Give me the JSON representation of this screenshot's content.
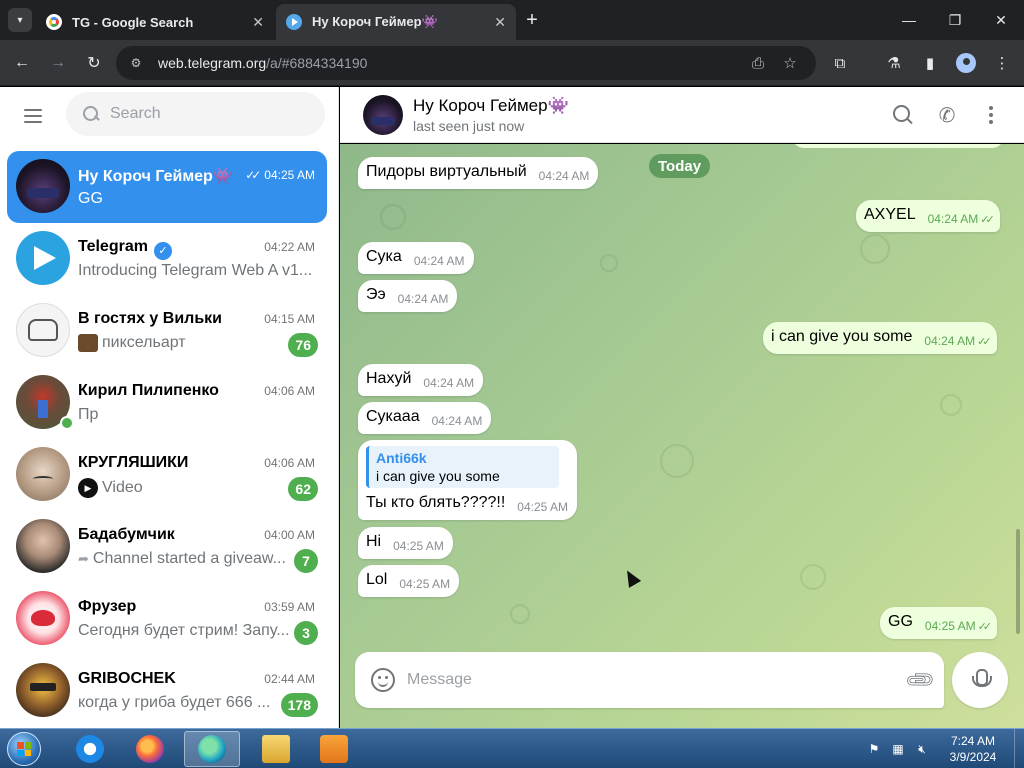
{
  "browser": {
    "tabs": [
      {
        "title": "TG - Google Search",
        "active": false
      },
      {
        "title": "Ну Короч Геймер👾",
        "active": true
      }
    ],
    "url_host": "web.telegram.org",
    "url_path": "/a/#6884334190"
  },
  "sidebar": {
    "search_placeholder": "Search",
    "chats": [
      {
        "name": "Ну Короч Геймер👾",
        "time": "04:25 AM",
        "preview": "GG",
        "badge": "",
        "active": true,
        "read_ticks": "✓✓"
      },
      {
        "name": "Telegram",
        "time": "04:22 AM",
        "preview": "Introducing Telegram Web A v1...",
        "badge": "",
        "verified": true
      },
      {
        "name": "В гостях у Вильки",
        "time": "04:15 AM",
        "preview": "пиксельарт",
        "badge": "76"
      },
      {
        "name": "Кирил Пилипенко",
        "time": "04:06 AM",
        "preview": "Пр",
        "badge": "",
        "online": true
      },
      {
        "name": "КРУГЛЯШИКИ",
        "time": "04:06 AM",
        "preview": "Video",
        "badge": "62"
      },
      {
        "name": "Бадабумчик",
        "time": "04:00 AM",
        "preview": "Channel started a giveaw...",
        "badge": "7"
      },
      {
        "name": "Фрузер",
        "time": "03:59 AM",
        "preview": "Сегодня будет стрим! Запу...",
        "badge": "3"
      },
      {
        "name": "GRIBOCHEK",
        "time": "02:44 AM",
        "preview": "когда у гриба будет 666 ...",
        "badge": "178"
      }
    ]
  },
  "chat": {
    "name": "Ну Короч Геймер👾",
    "status": "last seen just now",
    "date_label": "Today",
    "messages": [
      {
        "dir": "in",
        "text": "Пидоры виртуальный",
        "time": "04:24 AM"
      },
      {
        "dir": "out",
        "text": "AXYEL",
        "time": "04:24 AM"
      },
      {
        "dir": "in",
        "text": "Сука",
        "time": "04:24 AM"
      },
      {
        "dir": "in",
        "text": "Ээ",
        "time": "04:24 AM"
      },
      {
        "dir": "out",
        "text": "i can give you some",
        "time": "04:24 AM"
      },
      {
        "dir": "in",
        "text": "Нахуй",
        "time": "04:24 AM"
      },
      {
        "dir": "in",
        "text": "Сукааа",
        "time": "04:24 AM"
      },
      {
        "dir": "in",
        "text": "Ты кто блять????!!",
        "time": "04:25 AM",
        "reply_name": "Anti66k",
        "reply_text": "i can give you some"
      },
      {
        "dir": "in",
        "text": "Hi",
        "time": "04:25 AM"
      },
      {
        "dir": "in",
        "text": "Lol",
        "time": "04:25 AM"
      },
      {
        "dir": "out",
        "text": "GG",
        "time": "04:25 AM"
      }
    ],
    "composer_placeholder": "Message"
  },
  "taskbar": {
    "time": "7:24 AM",
    "date": "3/9/2024"
  },
  "colors": {
    "accent": "#3390ec",
    "unread_badge": "#4fae4e",
    "outgoing_bubble": "#eeffde"
  }
}
